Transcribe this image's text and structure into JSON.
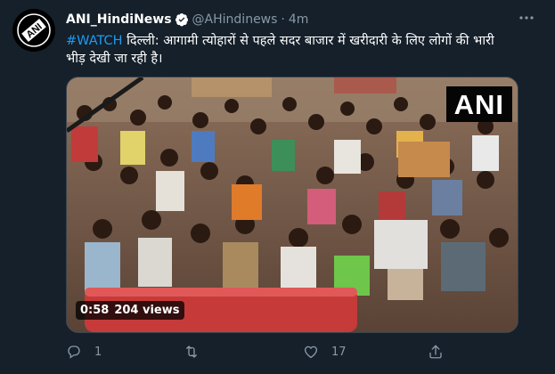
{
  "tweet": {
    "author_name": "ANI_HindiNews",
    "handle": "@AHindinews",
    "separator": "·",
    "time": "4m",
    "hashtag": "#WATCH",
    "text": " दिल्ली: आगामी त्योहारों से पहले सदर बाजार में खरीदारी के लिए लोगों की भारी भीड़ देखी जा रही है।",
    "avatar_text": "ANI"
  },
  "media": {
    "watermark": "ANI",
    "duration": "0:58",
    "views": "204 views"
  },
  "actions": {
    "reply_count": "1",
    "retweet_count": "",
    "like_count": "17",
    "share_count": ""
  },
  "icons": [
    "verified-badge-icon",
    "more-icon",
    "reply-icon",
    "retweet-icon",
    "like-icon",
    "share-icon"
  ],
  "colors": {
    "background": "#15202b",
    "accent": "#1d9bf0",
    "muted": "#8899a6"
  }
}
